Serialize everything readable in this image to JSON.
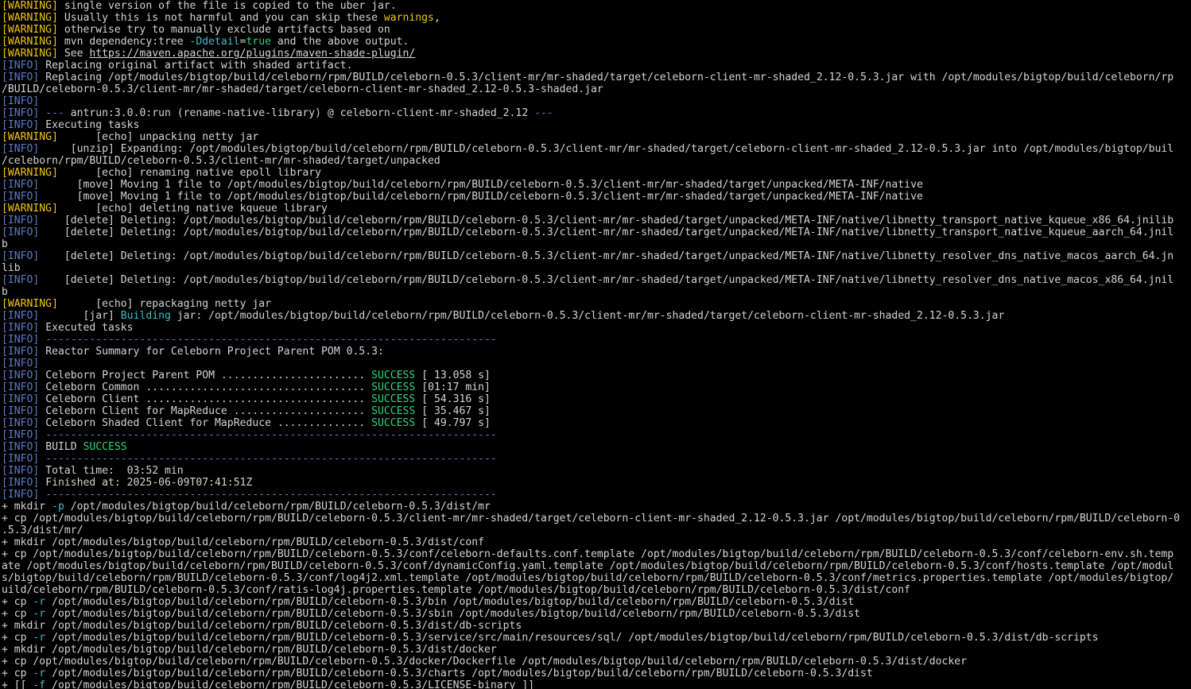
{
  "terminal": {
    "colors": {
      "background": "#000000",
      "foreground": "#d4d4d4",
      "warning": "#f1c40f",
      "info": "#5b7cc7",
      "success": "#2ed47a",
      "highlight": "#45b8c9"
    },
    "lines": [
      [
        {
          "t": "[WARNING]",
          "c": "warn"
        },
        {
          "t": " single version of the file is copied to the uber jar."
        }
      ],
      [
        {
          "t": "[WARNING]",
          "c": "warn"
        },
        {
          "t": " Usually this is not harmful and you can skip these "
        },
        {
          "t": "warnings",
          "c": "warn"
        },
        {
          "t": ","
        }
      ],
      [
        {
          "t": "[WARNING]",
          "c": "warn"
        },
        {
          "t": " otherwise try to manually exclude artifacts based on"
        }
      ],
      [
        {
          "t": "[WARNING]",
          "c": "warn"
        },
        {
          "t": " mvn dependency:tree "
        },
        {
          "t": "-Ddetail",
          "c": "cyan"
        },
        {
          "t": "="
        },
        {
          "t": "true",
          "c": "succ"
        },
        {
          "t": " and the above output."
        }
      ],
      [
        {
          "t": "[WARNING]",
          "c": "warn"
        },
        {
          "t": " See "
        },
        {
          "t": "https://maven.apache.org/plugins/maven-shade-plugin/",
          "c": "link"
        }
      ],
      [
        {
          "t": "[INFO]",
          "c": "info"
        },
        {
          "t": " Replacing original artifact with shaded artifact."
        }
      ],
      [
        {
          "t": "[INFO]",
          "c": "info"
        },
        {
          "t": " Replacing /opt/modules/bigtop/build/celeborn/rpm/BUILD/celeborn-0.5.3/client-mr/mr-shaded/target/celeborn-client-mr-shaded_2.12-0.5.3.jar with /opt/modules/bigtop/build/celeborn/rp"
        }
      ],
      [
        {
          "t": "/BUILD/celeborn-0.5.3/client-mr/mr-shaded/target/celeborn-client-mr-shaded_2.12-0.5.3-shaded.jar"
        }
      ],
      [
        {
          "t": "[INFO]",
          "c": "info"
        }
      ],
      [
        {
          "t": "[INFO]",
          "c": "info"
        },
        {
          "t": " --- ",
          "c": "info"
        },
        {
          "t": "antrun:3.0.0:run (rename-native-library) @ celeborn-client-mr-shaded_2.12"
        },
        {
          "t": " ---",
          "c": "info"
        }
      ],
      [
        {
          "t": "[INFO]",
          "c": "info"
        },
        {
          "t": " Executing tasks"
        }
      ],
      [
        {
          "t": "[WARNING]",
          "c": "warn"
        },
        {
          "t": "      [echo] unpacking netty jar"
        }
      ],
      [
        {
          "t": "[INFO]",
          "c": "info"
        },
        {
          "t": "     [unzip] Expanding: /opt/modules/bigtop/build/celeborn/rpm/BUILD/celeborn-0.5.3/client-mr/mr-shaded/target/celeborn-client-mr-shaded_2.12-0.5.3.jar into /opt/modules/bigtop/buil"
        }
      ],
      [
        {
          "t": "/celeborn/rpm/BUILD/celeborn-0.5.3/client-mr/mr-shaded/target/unpacked"
        }
      ],
      [
        {
          "t": "[WARNING]",
          "c": "warn"
        },
        {
          "t": "      [echo] renaming native epoll library"
        }
      ],
      [
        {
          "t": "[INFO]",
          "c": "info"
        },
        {
          "t": "      [move] Moving 1 file to /opt/modules/bigtop/build/celeborn/rpm/BUILD/celeborn-0.5.3/client-mr/mr-shaded/target/unpacked/META-INF/native"
        }
      ],
      [
        {
          "t": "[INFO]",
          "c": "info"
        },
        {
          "t": "      [move] Moving 1 file to /opt/modules/bigtop/build/celeborn/rpm/BUILD/celeborn-0.5.3/client-mr/mr-shaded/target/unpacked/META-INF/native"
        }
      ],
      [
        {
          "t": "[WARNING]",
          "c": "warn"
        },
        {
          "t": "      [echo] deleting native kqueue library"
        }
      ],
      [
        {
          "t": "[INFO]",
          "c": "info"
        },
        {
          "t": "    [delete] Deleting: /opt/modules/bigtop/build/celeborn/rpm/BUILD/celeborn-0.5.3/client-mr/mr-shaded/target/unpacked/META-INF/native/libnetty_transport_native_kqueue_x86_64.jnilib"
        }
      ],
      [
        {
          "t": "[INFO]",
          "c": "info"
        },
        {
          "t": "    [delete] Deleting: /opt/modules/bigtop/build/celeborn/rpm/BUILD/celeborn-0.5.3/client-mr/mr-shaded/target/unpacked/META-INF/native/libnetty_transport_native_kqueue_aarch_64.jnil"
        }
      ],
      [
        {
          "t": "b"
        }
      ],
      [
        {
          "t": "[INFO]",
          "c": "info"
        },
        {
          "t": "    [delete] Deleting: /opt/modules/bigtop/build/celeborn/rpm/BUILD/celeborn-0.5.3/client-mr/mr-shaded/target/unpacked/META-INF/native/libnetty_resolver_dns_native_macos_aarch_64.jn"
        }
      ],
      [
        {
          "t": "lib"
        }
      ],
      [
        {
          "t": "[INFO]",
          "c": "info"
        },
        {
          "t": "    [delete] Deleting: /opt/modules/bigtop/build/celeborn/rpm/BUILD/celeborn-0.5.3/client-mr/mr-shaded/target/unpacked/META-INF/native/libnetty_resolver_dns_native_macos_x86_64.jnil"
        }
      ],
      [
        {
          "t": "b"
        }
      ],
      [
        {
          "t": "[WARNING]",
          "c": "warn"
        },
        {
          "t": "      [echo] repackaging netty jar"
        }
      ],
      [
        {
          "t": "[INFO]",
          "c": "info"
        },
        {
          "t": "       [jar] "
        },
        {
          "t": "Building",
          "c": "cyan"
        },
        {
          "t": " jar: /opt/modules/bigtop/build/celeborn/rpm/BUILD/celeborn-0.5.3/client-mr/mr-shaded/target/celeborn-client-mr-shaded_2.12-0.5.3.jar"
        }
      ],
      [
        {
          "t": "[INFO]",
          "c": "info"
        },
        {
          "t": " Executed tasks"
        }
      ],
      [
        {
          "t": "[INFO]",
          "c": "info"
        },
        {
          "t": " ------------------------------------------------------------------------",
          "c": "info"
        }
      ],
      [
        {
          "t": "[INFO]",
          "c": "info"
        },
        {
          "t": " Reactor Summary for Celeborn Project Parent POM 0.5.3:"
        }
      ],
      [
        {
          "t": "[INFO]",
          "c": "info"
        }
      ],
      [
        {
          "t": "[INFO]",
          "c": "info"
        },
        {
          "t": " Celeborn Project Parent POM ....................... "
        },
        {
          "t": "SUCCESS",
          "c": "succ"
        },
        {
          "t": " [ 13.058 s]"
        }
      ],
      [
        {
          "t": "[INFO]",
          "c": "info"
        },
        {
          "t": " Celeborn Common ................................... "
        },
        {
          "t": "SUCCESS",
          "c": "succ"
        },
        {
          "t": " [01:17 min]"
        }
      ],
      [
        {
          "t": "[INFO]",
          "c": "info"
        },
        {
          "t": " Celeborn Client ................................... "
        },
        {
          "t": "SUCCESS",
          "c": "succ"
        },
        {
          "t": " [ 54.316 s]"
        }
      ],
      [
        {
          "t": "[INFO]",
          "c": "info"
        },
        {
          "t": " Celeborn Client for MapReduce ..................... "
        },
        {
          "t": "SUCCESS",
          "c": "succ"
        },
        {
          "t": " [ 35.467 s]"
        }
      ],
      [
        {
          "t": "[INFO]",
          "c": "info"
        },
        {
          "t": " Celeborn Shaded Client for MapReduce .............. "
        },
        {
          "t": "SUCCESS",
          "c": "succ"
        },
        {
          "t": " [ 49.797 s]"
        }
      ],
      [
        {
          "t": "[INFO]",
          "c": "info"
        },
        {
          "t": " ------------------------------------------------------------------------",
          "c": "info"
        }
      ],
      [
        {
          "t": "[INFO]",
          "c": "info"
        },
        {
          "t": " BUILD "
        },
        {
          "t": "SUCCESS",
          "c": "succ"
        }
      ],
      [
        {
          "t": "[INFO]",
          "c": "info"
        },
        {
          "t": " ------------------------------------------------------------------------",
          "c": "info"
        }
      ],
      [
        {
          "t": "[INFO]",
          "c": "info"
        },
        {
          "t": " Total time:  03:52 min"
        }
      ],
      [
        {
          "t": "[INFO]",
          "c": "info"
        },
        {
          "t": " Finished at: 2025-06-09T07:41:51Z"
        }
      ],
      [
        {
          "t": "[INFO]",
          "c": "info"
        },
        {
          "t": " ------------------------------------------------------------------------",
          "c": "info"
        }
      ],
      [
        {
          "t": "+ mkdir "
        },
        {
          "t": "-p",
          "c": "cyan"
        },
        {
          "t": " /opt/modules/bigtop/build/celeborn/rpm/BUILD/celeborn-0.5.3/dist/mr"
        }
      ],
      [
        {
          "t": "+ cp /opt/modules/bigtop/build/celeborn/rpm/BUILD/celeborn-0.5.3/client-mr/mr-shaded/target/celeborn-client-mr-shaded_2.12-0.5.3.jar /opt/modules/bigtop/build/celeborn/rpm/BUILD/celeborn-0"
        }
      ],
      [
        {
          "t": ".5.3/dist/mr/"
        }
      ],
      [
        {
          "t": "+ mkdir /opt/modules/bigtop/build/celeborn/rpm/BUILD/celeborn-0.5.3/dist/conf"
        }
      ],
      [
        {
          "t": "+ cp /opt/modules/bigtop/build/celeborn/rpm/BUILD/celeborn-0.5.3/conf/celeborn-defaults.conf.template /opt/modules/bigtop/build/celeborn/rpm/BUILD/celeborn-0.5.3/conf/celeborn-env.sh.temp"
        }
      ],
      [
        {
          "t": "ate /opt/modules/bigtop/build/celeborn/rpm/BUILD/celeborn-0.5.3/conf/dynamicConfig.yaml.template /opt/modules/bigtop/build/celeborn/rpm/BUILD/celeborn-0.5.3/conf/hosts.template /opt/modul"
        }
      ],
      [
        {
          "t": "s/bigtop/build/celeborn/rpm/BUILD/celeborn-0.5.3/conf/log4j2.xml.template /opt/modules/bigtop/build/celeborn/rpm/BUILD/celeborn-0.5.3/conf/metrics.properties.template /opt/modules/bigtop/"
        }
      ],
      [
        {
          "t": "uild/celeborn/rpm/BUILD/celeborn-0.5.3/conf/ratis-log4j.properties.template /opt/modules/bigtop/build/celeborn/rpm/BUILD/celeborn-0.5.3/dist/conf"
        }
      ],
      [
        {
          "t": "+ cp "
        },
        {
          "t": "-r",
          "c": "cyan"
        },
        {
          "t": " /opt/modules/bigtop/build/celeborn/rpm/BUILD/celeborn-0.5.3/bin /opt/modules/bigtop/build/celeborn/rpm/BUILD/celeborn-0.5.3/dist"
        }
      ],
      [
        {
          "t": "+ cp "
        },
        {
          "t": "-r",
          "c": "cyan"
        },
        {
          "t": " /opt/modules/bigtop/build/celeborn/rpm/BUILD/celeborn-0.5.3/sbin /opt/modules/bigtop/build/celeborn/rpm/BUILD/celeborn-0.5.3/dist"
        }
      ],
      [
        {
          "t": "+ mkdir /opt/modules/bigtop/build/celeborn/rpm/BUILD/celeborn-0.5.3/dist/db-scripts"
        }
      ],
      [
        {
          "t": "+ cp "
        },
        {
          "t": "-r",
          "c": "cyan"
        },
        {
          "t": " /opt/modules/bigtop/build/celeborn/rpm/BUILD/celeborn-0.5.3/service/src/main/resources/sql/ /opt/modules/bigtop/build/celeborn/rpm/BUILD/celeborn-0.5.3/dist/db-scripts"
        }
      ],
      [
        {
          "t": "+ mkdir /opt/modules/bigtop/build/celeborn/rpm/BUILD/celeborn-0.5.3/dist/docker"
        }
      ],
      [
        {
          "t": "+ cp /opt/modules/bigtop/build/celeborn/rpm/BUILD/celeborn-0.5.3/docker/Dockerfile /opt/modules/bigtop/build/celeborn/rpm/BUILD/celeborn-0.5.3/dist/docker"
        }
      ],
      [
        {
          "t": "+ cp "
        },
        {
          "t": "-r",
          "c": "cyan"
        },
        {
          "t": " /opt/modules/bigtop/build/celeborn/rpm/BUILD/celeborn-0.5.3/charts /opt/modules/bigtop/build/celeborn/rpm/BUILD/celeborn-0.5.3/dist"
        }
      ],
      [
        {
          "t": "+ [[ "
        },
        {
          "t": "-f",
          "c": "cyan"
        },
        {
          "t": " /opt/modules/bigtop/build/celeborn/rpm/BUILD/celeborn-0.5.3/LICENSE-binary ]]"
        }
      ]
    ]
  }
}
